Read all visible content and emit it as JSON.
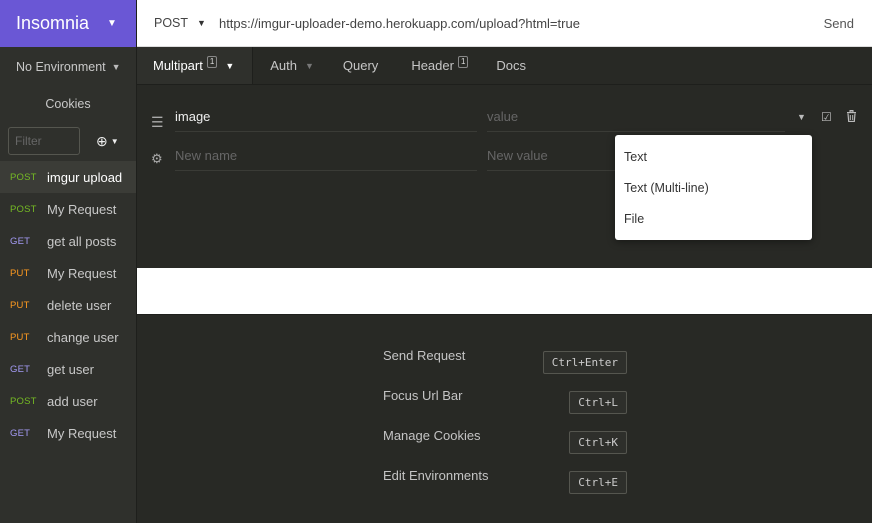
{
  "app": {
    "name": "Insomnia"
  },
  "sidebar": {
    "environment": "No Environment",
    "cookies_label": "Cookies",
    "filter_placeholder": "Filter",
    "requests": [
      {
        "method": "POST",
        "name": "imgur upload",
        "active": true
      },
      {
        "method": "POST",
        "name": "My Request"
      },
      {
        "method": "GET",
        "name": "get all posts"
      },
      {
        "method": "PUT",
        "name": "My Request"
      },
      {
        "method": "PUT",
        "name": "delete user"
      },
      {
        "method": "PUT",
        "name": "change user"
      },
      {
        "method": "GET",
        "name": "get user"
      },
      {
        "method": "POST",
        "name": "add user"
      },
      {
        "method": "GET",
        "name": "My Request"
      }
    ]
  },
  "urlbar": {
    "method": "POST",
    "url": "https://imgur-uploader-demo.herokuapp.com/upload?html=true",
    "send_label": "Send"
  },
  "tabs": {
    "body": {
      "label": "Multipart",
      "count": "1"
    },
    "auth": {
      "label": "Auth"
    },
    "query": {
      "label": "Query"
    },
    "header": {
      "label": "Header",
      "count": "1"
    },
    "docs": {
      "label": "Docs"
    }
  },
  "form": {
    "row1": {
      "name": "image",
      "value_placeholder": "value"
    },
    "row2": {
      "name_placeholder": "New name",
      "value_placeholder": "New value"
    }
  },
  "dropdown": {
    "items": [
      "Text",
      "Text (Multi-line)",
      "File"
    ]
  },
  "shortcuts": [
    {
      "label": "Send Request",
      "key": "Ctrl+Enter"
    },
    {
      "label": "Focus Url Bar",
      "key": "Ctrl+L"
    },
    {
      "label": "Manage Cookies",
      "key": "Ctrl+K"
    },
    {
      "label": "Edit Environments",
      "key": "Ctrl+E"
    }
  ],
  "colors": {
    "brand": "#6a57d5",
    "post": "#75ba24",
    "get": "#a49bf5",
    "put": "#ff9a1f"
  }
}
